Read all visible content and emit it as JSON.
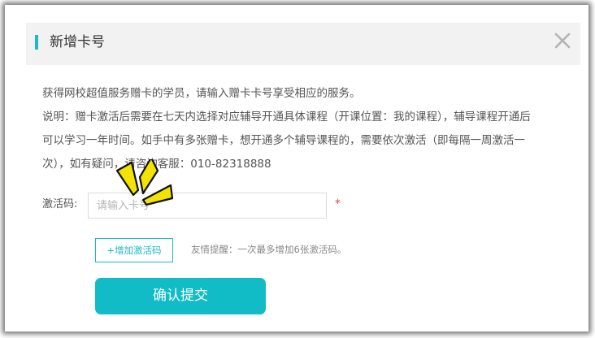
{
  "dialog": {
    "title": "新增卡号",
    "close_icon": "close-icon"
  },
  "content": {
    "intro": "获得网校超值服务赠卡的学员，请输入赠卡卡号享受相应的服务。",
    "notes": [
      "说明：赠卡激活后需要在七天内选择对应辅导开通具体课程（开课位置：我的课程），辅导课程开通后",
      "可以学习一年时间。如手中有多张赠卡，想开通多个辅导课程的，需要依次激活（即每隔一周激活一",
      "次），如有疑问，请咨询客服：010-82318888"
    ]
  },
  "form": {
    "label": "激活码:",
    "placeholder": "请输入卡号",
    "value": "",
    "required_mark": "*",
    "add_button": "+增加激活码",
    "tip": "友情提醒：一次最多增加6张激活码。",
    "submit_button": "确认提交"
  },
  "colors": {
    "accent": "#1bb9c9",
    "submit": "#12bcc7",
    "header_bg": "#f2f2f2",
    "required": "#e8473f",
    "annotation": "#f2e300"
  },
  "annotation_icon": "spark-highlight-icon"
}
